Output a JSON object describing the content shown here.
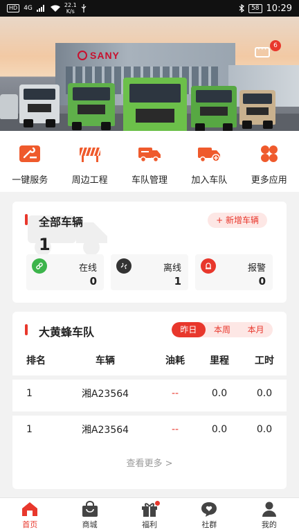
{
  "status_bar": {
    "hd": "HD",
    "signal": "4G",
    "speed_top": "22.1",
    "speed_bottom": "K/s",
    "battery": "58",
    "time": "10:29"
  },
  "hero": {
    "brand": "SANY",
    "message_badge": "6"
  },
  "quick_menu": [
    {
      "label": "一键服务",
      "icon": "wrench-service-icon"
    },
    {
      "label": "周边工程",
      "icon": "barrier-icon"
    },
    {
      "label": "车队管理",
      "icon": "truck-manage-icon"
    },
    {
      "label": "加入车队",
      "icon": "truck-add-icon"
    },
    {
      "label": "更多应用",
      "icon": "grid-apps-icon"
    }
  ],
  "vehicles": {
    "title": "全部车辆",
    "add_button": "+ 新增车辆",
    "total": "1",
    "stats": [
      {
        "label": "在线",
        "value": "0",
        "color": "#3cb44b",
        "icon": "link-icon"
      },
      {
        "label": "离线",
        "value": "1",
        "color": "#333333",
        "icon": "unlink-icon"
      },
      {
        "label": "报警",
        "value": "0",
        "color": "#e8372c",
        "icon": "alarm-icon"
      }
    ]
  },
  "fleet": {
    "title": "大黄蜂车队",
    "tabs": [
      "昨日",
      "本周",
      "本月"
    ],
    "active_tab": "昨日",
    "columns": [
      "排名",
      "车辆",
      "油耗",
      "里程",
      "工时"
    ],
    "rows": [
      {
        "rank": "1",
        "vehicle": "湘A23564",
        "fuel": "--",
        "mileage": "0.0",
        "hours": "0.0"
      },
      {
        "rank": "1",
        "vehicle": "湘A23564",
        "fuel": "--",
        "mileage": "0.0",
        "hours": "0.0"
      }
    ],
    "more": "查看更多 >"
  },
  "tabbar": [
    {
      "label": "首页",
      "icon": "home-icon",
      "active": true
    },
    {
      "label": "商城",
      "icon": "shop-bag-icon",
      "active": false
    },
    {
      "label": "福利",
      "icon": "gift-icon",
      "active": false
    },
    {
      "label": "社群",
      "icon": "chat-heart-icon",
      "active": false
    },
    {
      "label": "我的",
      "icon": "user-icon",
      "active": false
    }
  ],
  "colors": {
    "accent": "#e8372c",
    "online": "#3cb44b"
  }
}
